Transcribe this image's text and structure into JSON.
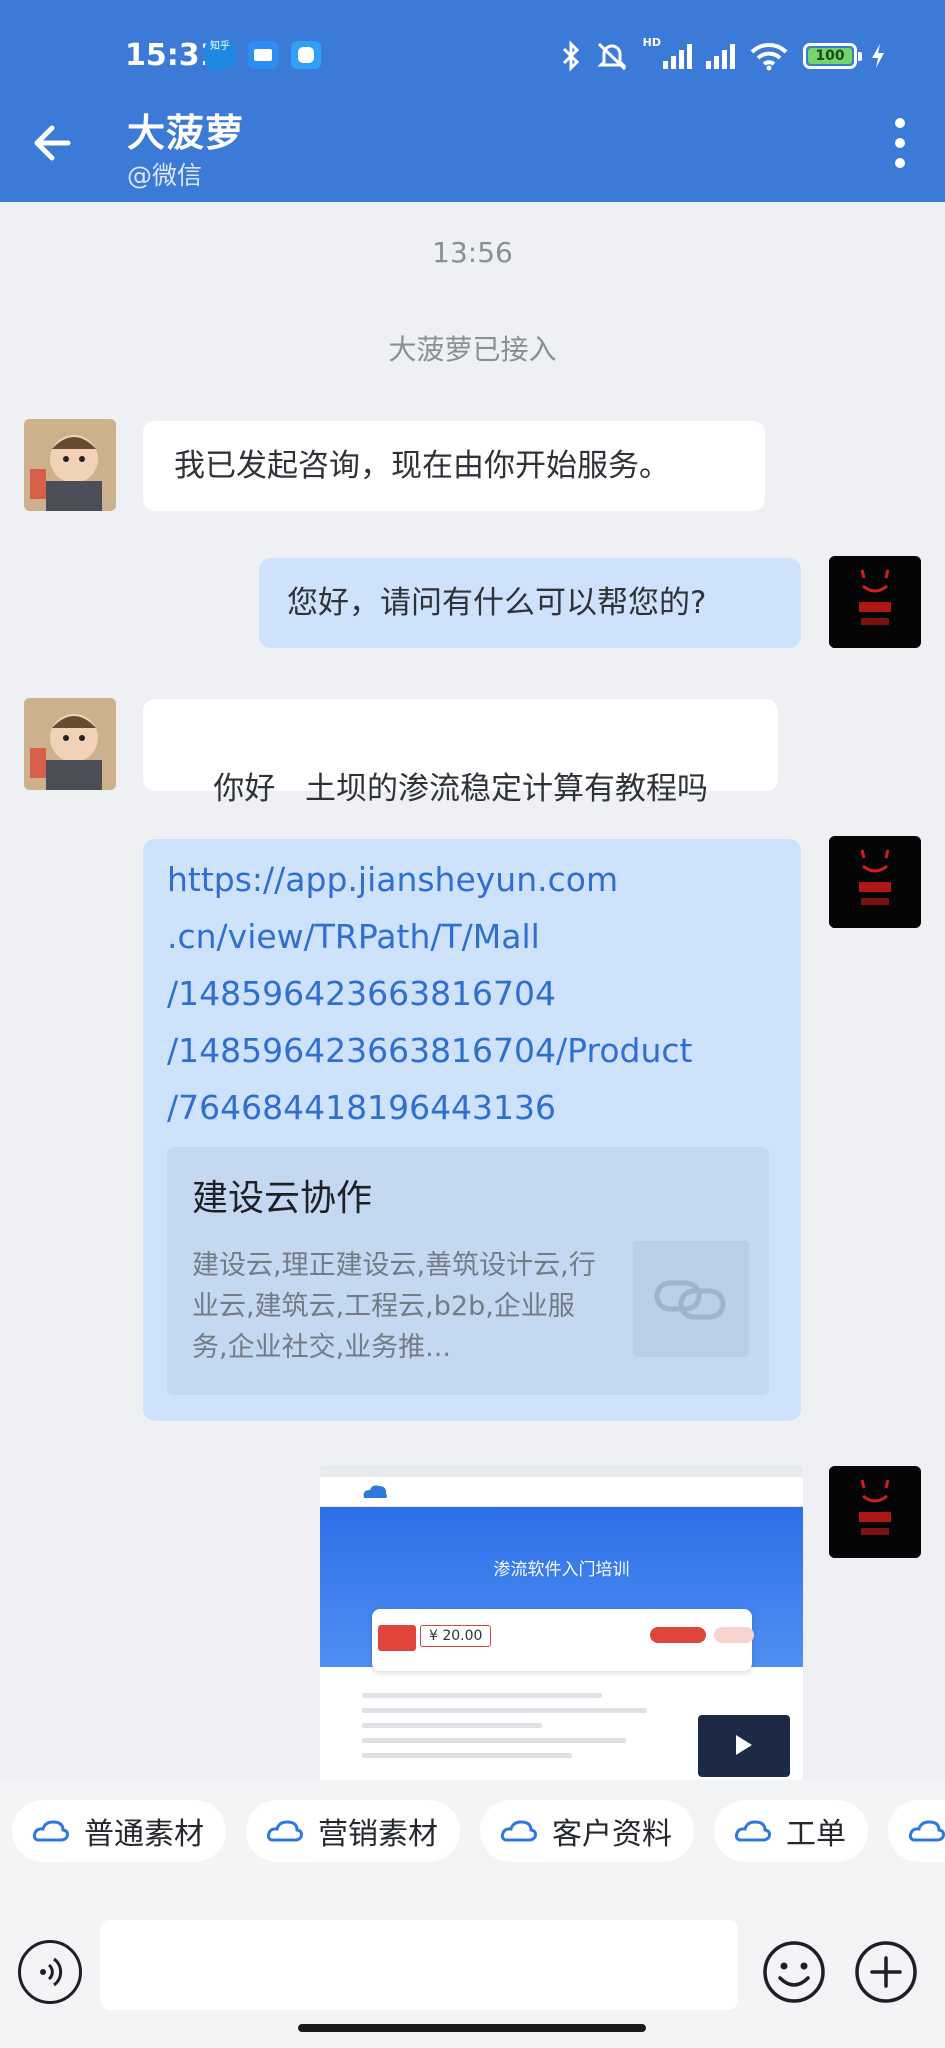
{
  "status_bar": {
    "time": "15:31",
    "zhihu_badge": "知乎",
    "battery": "100",
    "network": "HD"
  },
  "header": {
    "title": "大菠萝",
    "subtitle": "@微信"
  },
  "chat": {
    "timestamp": "13:56",
    "system_notice": "大菠萝已接入",
    "messages": [
      {
        "side": "in",
        "text": "我已发起咨询，现在由你开始服务。"
      },
      {
        "side": "out",
        "text": "您好，请问有什么可以帮您的?"
      },
      {
        "side": "in",
        "text": "你好   土坝的渗流稳定计算有教程吗"
      }
    ],
    "link_card": {
      "url_lines": [
        "https://app.jiansheyun.com",
        ".cn/view/TRPath/T/Mall",
        "/148596423663816704",
        "/148596423663816704/Product",
        "/764684418196443136"
      ],
      "preview_title": "建设云协作",
      "preview_desc": "建设云,理正建设云,善筑设计云,行业云,建筑云,工程云,b2b,企业服务,企业社交,业务推..."
    },
    "screenshot": {
      "hero_title": "渗流软件入门培训",
      "price": "¥ 20.00"
    }
  },
  "quick_actions": [
    "普通素材",
    "营销素材",
    "客户资料",
    "工单"
  ],
  "input": {
    "placeholder": ""
  },
  "colors": {
    "header": "#3b7ad6",
    "bubble_out": "#cfe2fb",
    "bubble_in": "#ffffff",
    "link": "#2f6fd0"
  }
}
